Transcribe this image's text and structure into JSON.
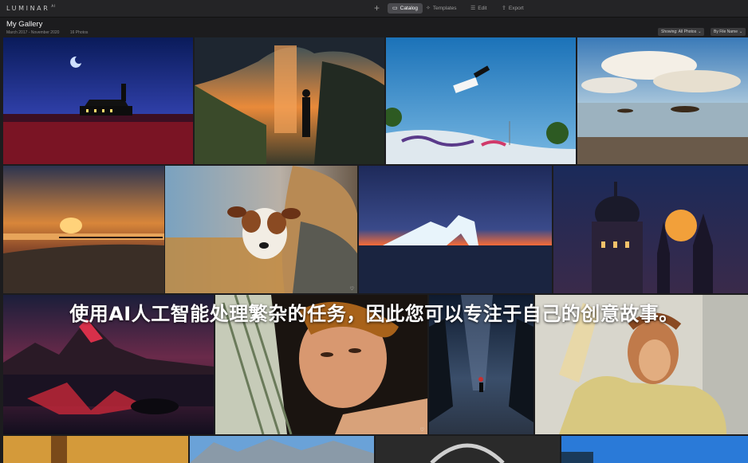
{
  "app": {
    "logo": "LUMINAR",
    "logo_sup": "AI"
  },
  "toolbar": {
    "add_icon": "plus-icon",
    "tabs": [
      {
        "label": "Catalog",
        "icon": "folder-icon",
        "active": true
      },
      {
        "label": "Templates",
        "icon": "sparkle-icon",
        "active": false
      },
      {
        "label": "Edit",
        "icon": "sliders-icon",
        "active": false
      },
      {
        "label": "Export",
        "icon": "share-icon",
        "active": false
      }
    ]
  },
  "gallery": {
    "title": "My Gallery",
    "date_range": "March 2017 - November 2020",
    "count": "16 Photos",
    "showing": "Showing: All Photos",
    "sort": "By File Name"
  },
  "overlay_text": "使用AI人工智能处理繁杂的任务，因此您可以专注于自己的创意故事。",
  "colors": {
    "selection": "#5fd1ef",
    "background": "#1c1c1e",
    "topbar": "#242426"
  }
}
